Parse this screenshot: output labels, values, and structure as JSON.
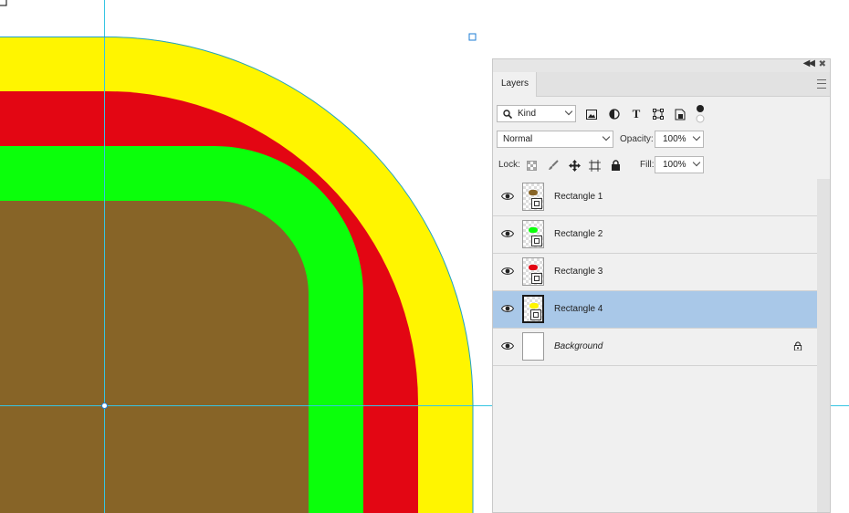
{
  "colors": {
    "yellow": "#FFF500",
    "red": "#E30613",
    "green": "#0BFF0B",
    "brown": "#876427",
    "guide": "#36C5E3",
    "selection": "#a9c8e8"
  },
  "panel": {
    "tab_label": "Layers",
    "filter": {
      "value": "Kind"
    },
    "filter_icons": [
      "image-filter-icon",
      "adjustment-filter-icon",
      "type-filter-icon",
      "shape-filter-icon",
      "smart-object-filter-icon",
      "filter-toggle-icon"
    ],
    "blend_mode": "Normal",
    "opacity_label": "Opacity:",
    "opacity_value": "100%",
    "lock_label": "Lock:",
    "lock_icons": [
      "lock-transparent-icon",
      "lock-image-icon",
      "lock-position-icon",
      "lock-artboard-icon",
      "lock-all-icon"
    ],
    "fill_label": "Fill:",
    "fill_value": "100%"
  },
  "layers": [
    {
      "name": "Rectangle 1",
      "swatch": "#876427",
      "selected": false
    },
    {
      "name": "Rectangle 2",
      "swatch": "#0BFF0B",
      "selected": false
    },
    {
      "name": "Rectangle 3",
      "swatch": "#E30613",
      "selected": false
    },
    {
      "name": "Rectangle  4",
      "swatch": "#FFF500",
      "selected": true
    },
    {
      "name": "Background",
      "swatch": "",
      "selected": false,
      "locked": true
    }
  ]
}
